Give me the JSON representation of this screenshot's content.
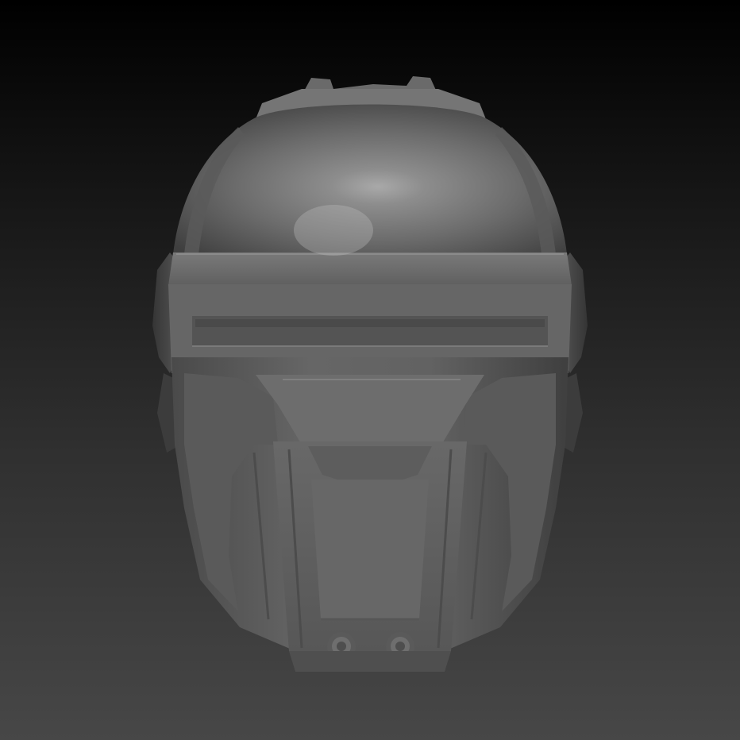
{
  "viewport": {
    "background_top": "#000000",
    "background_bottom": "#474747"
  },
  "model": {
    "subject": "helmet-3d-sculpt",
    "material_base": "#6e6e6e",
    "material_highlight": "#a8a8a8",
    "material_shadow": "#3a3a3a"
  }
}
